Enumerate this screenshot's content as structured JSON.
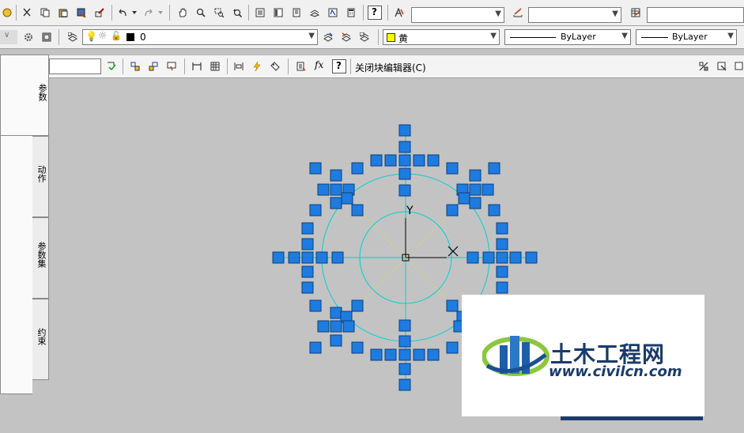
{
  "toolbar1": {
    "combo_text_style": "",
    "combo_dim_style": "",
    "combo_table_style": ""
  },
  "toolbar2": {
    "layer_name": "0",
    "color_name": "黄",
    "linetype": "ByLayer",
    "lineweight": "ByLayer",
    "colors": {
      "layer_fill": "#000000",
      "color_swatch": "#ffff00"
    }
  },
  "block_editor": {
    "close_label": "关闭块编辑器(C)",
    "fx_label": "fx",
    "help_label": "?"
  },
  "palette": {
    "tabs": [
      "参数",
      "动作",
      "参数集",
      "约束"
    ]
  },
  "canvas": {
    "background": "#c3c3c3",
    "grip_color": "#1e7be0",
    "circle_color": "#00d0d0",
    "ucs_y_label": "Y"
  },
  "watermark": {
    "title": "土木工程网",
    "url": "www.civilcn.com"
  }
}
